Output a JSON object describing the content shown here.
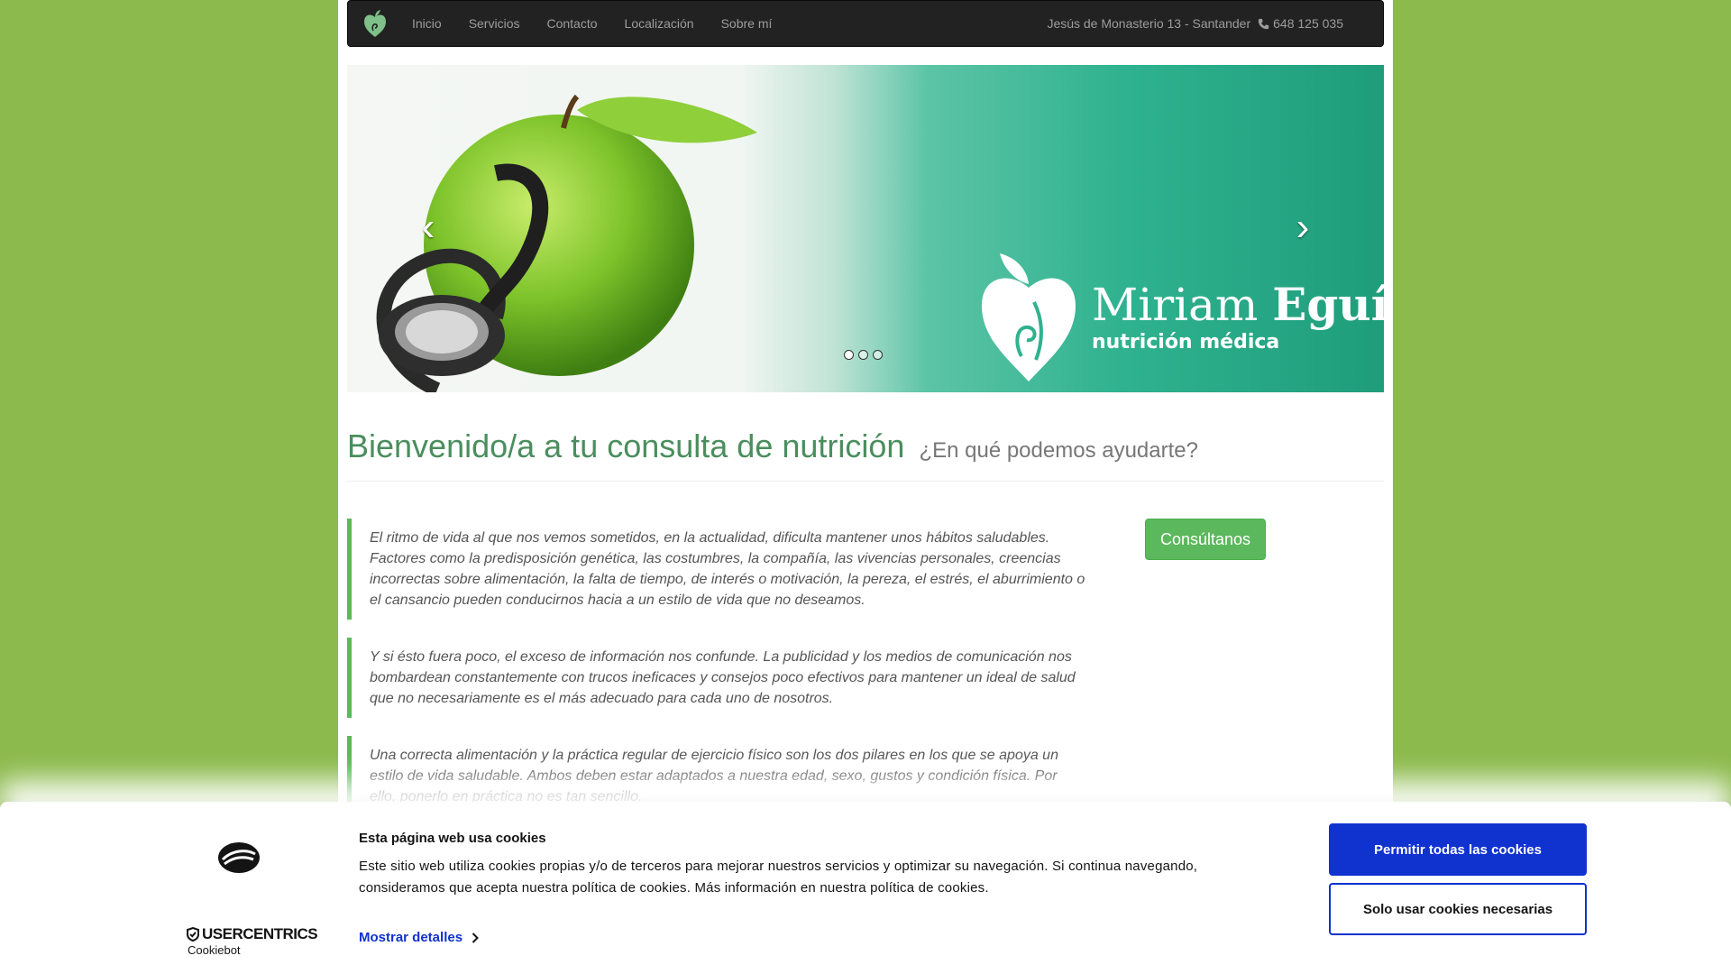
{
  "navbar": {
    "brand_icon": "apple-heart-logo-icon",
    "links": [
      "Inicio",
      "Servicios",
      "Contacto",
      "Localización",
      "Sobre mí"
    ],
    "address": "Jesús de Monasterio 13 - Santander",
    "phone": "648 125 035",
    "phone_icon": "phone-icon"
  },
  "carousel": {
    "prev_arrow": "‹",
    "next_arrow": "›",
    "slide_count_dots": 3,
    "active_slide": 1,
    "logo_name_light": "Miriam ",
    "logo_name_bold": "Eguía",
    "logo_subtitle": "nutrición médica"
  },
  "header": {
    "title": "Bienvenido/a a tu consulta de nutrición",
    "subtitle": "¿En qué podemos ayudarte?"
  },
  "quotes": [
    "El ritmo de vida al que nos vemos sometidos, en la actualidad, dificulta mantener unos hábitos saludables. Factores como la predisposición genética, las costumbres, la compañía, las vivencias personales, creencias incorrectas sobre alimentación, la falta de tiempo, de interés o motivación, la pereza, el estrés, el aburrimiento o el cansancio pueden conducirnos hacia a un estilo de vida que no deseamos.",
    "Y si ésto fuera poco, el exceso de información nos confunde. La publicidad y los medios de comunicación nos bombardean constantemente con trucos ineficaces y consejos poco efectivos para mantener un ideal de salud que no necesariamente es el más adecuado para cada uno de nosotros.",
    "Una correcta alimentación y la práctica regular de ejercicio físico son los dos pilares en los que se apoya un estilo de vida saludable. Ambos deben estar adaptados a nuestra edad, sexo, gustos y condición física. Por ello, ponerlo en práctica no es tan sencillo."
  ],
  "consult_button": "Consúltanos",
  "cookie_banner": {
    "title": "Esta página web usa cookies",
    "text": "Este sitio web utiliza cookies propias y/o de terceros para mejorar nuestros servicios y optimizar su navegación. Si continua navegando, consideramos que acepta nuestra política de cookies. Más información en nuestra política de cookies.",
    "details_link": "Mostrar detalles",
    "allow_all": "Permitir todas las cookies",
    "only_necessary": "Solo usar cookies necesarias",
    "provider_name": "USERCENTRICS",
    "provider_sub": "Cookiebot"
  },
  "colors": {
    "page_background": "#8cba4c",
    "navbar": "#222222",
    "heading_green": "#4a8e5d",
    "button_green": "#5cb85c",
    "cookie_blue": "#1032cf"
  }
}
